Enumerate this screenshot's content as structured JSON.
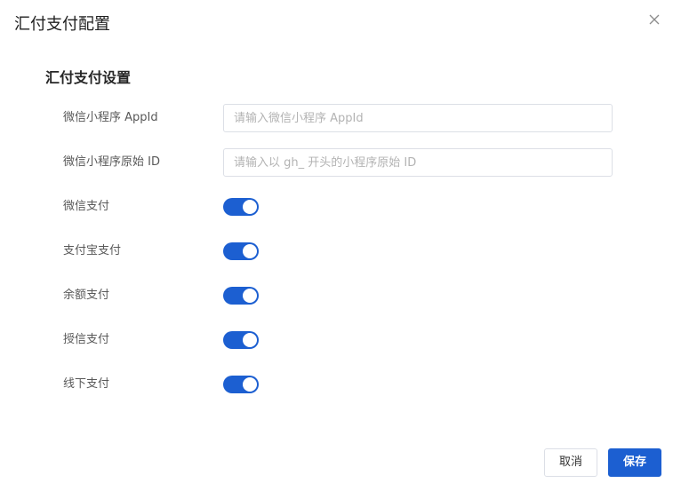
{
  "dialog": {
    "title": "汇付支付配置",
    "close_icon": "close-icon"
  },
  "section": {
    "title": "汇付支付设置"
  },
  "fields": {
    "appid": {
      "label": "微信小程序 AppId",
      "value": "",
      "placeholder": "请输入微信小程序 AppId"
    },
    "original_id": {
      "label": "微信小程序原始 ID",
      "value": "",
      "placeholder": "请输入以 gh_ 开头的小程序原始 ID"
    }
  },
  "toggles": [
    {
      "label": "微信支付",
      "on": true
    },
    {
      "label": "支付宝支付",
      "on": true
    },
    {
      "label": "余额支付",
      "on": true
    },
    {
      "label": "授信支付",
      "on": true
    },
    {
      "label": "线下支付",
      "on": true
    }
  ],
  "footer": {
    "cancel_label": "取消",
    "save_label": "保存"
  },
  "colors": {
    "accent": "#1c5fd1",
    "border": "#dcdfe6"
  }
}
